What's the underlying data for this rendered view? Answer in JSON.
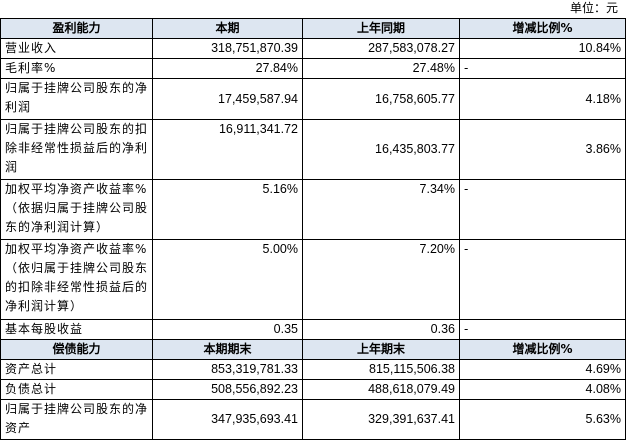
{
  "unit_label": "单位：元",
  "profit_section": {
    "headers": [
      "盈利能力",
      "本期",
      "上年同期",
      "增减比例%"
    ],
    "rows": [
      {
        "label": "营业收入",
        "current": "318,751,870.39",
        "previous": "287,583,078.27",
        "change": "10.84%"
      },
      {
        "label": "毛利率%",
        "current": "27.84%",
        "previous": "27.48%",
        "change": "-"
      },
      {
        "label": "归属于挂牌公司股东的净利润",
        "current": "17,459,587.94",
        "previous": "16,758,605.77",
        "change": "4.18%"
      },
      {
        "label": "归属于挂牌公司股东的扣除非经常性损益后的净利润",
        "current": "16,911,341.72",
        "previous": "16,435,803.77",
        "change": "3.86%"
      },
      {
        "label": "加权平均净资产收益率%（依据归属于挂牌公司股东的净利润计算）",
        "current": "5.16%",
        "previous": "7.34%",
        "change": "-"
      },
      {
        "label": "加权平均净资产收益率%（依归属于挂牌公司股东的扣除非经常性损益后的净利润计算）",
        "current": "5.00%",
        "previous": "7.20%",
        "change": "-"
      },
      {
        "label": "基本每股收益",
        "current": "0.35",
        "previous": "0.36",
        "change": "-"
      }
    ]
  },
  "solvency_section": {
    "headers": [
      "偿债能力",
      "本期期末",
      "上年期末",
      "增减比例%"
    ],
    "rows": [
      {
        "label": "资产总计",
        "current": "853,319,781.33",
        "previous": "815,115,506.38",
        "change": "4.69%"
      },
      {
        "label": "负债总计",
        "current": "508,556,892.23",
        "previous": "488,618,079.49",
        "change": "4.08%"
      },
      {
        "label": "归属于挂牌公司股东的净资产",
        "current": "347,935,693.41",
        "previous": "329,391,637.41",
        "change": "5.63%"
      }
    ]
  }
}
